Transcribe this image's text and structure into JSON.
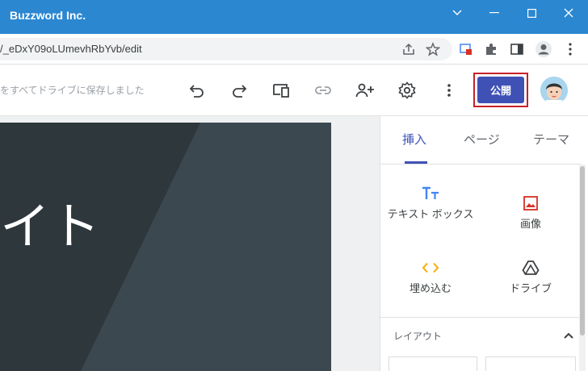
{
  "window": {
    "title": "Buzzword Inc."
  },
  "browser": {
    "url": "/_eDxY09oLUmevhRbYvb/edit"
  },
  "toolbar": {
    "save_status": "をすべてドライブに保存しました",
    "publish_label": "公開"
  },
  "canvas": {
    "hero_title": "イト"
  },
  "panel": {
    "tabs": [
      {
        "label": "挿入",
        "active": true
      },
      {
        "label": "ページ",
        "active": false
      },
      {
        "label": "テーマ",
        "active": false
      }
    ],
    "insert_items": [
      {
        "label": "テキスト ボックス",
        "icon": "text-box-icon"
      },
      {
        "label": "画像",
        "icon": "image-icon"
      },
      {
        "label": "埋め込む",
        "icon": "embed-icon"
      },
      {
        "label": "ドライブ",
        "icon": "drive-icon"
      }
    ],
    "layout_label": "レイアウト"
  },
  "colors": {
    "titlebar": "#2c87d1",
    "accent": "#3f51b5",
    "publish_outline": "#c8202a",
    "text_box_icon": "#4285f4",
    "image_icon": "#d93025",
    "embed_icon": "#f9ab00",
    "hero_background": "#3b484f"
  }
}
